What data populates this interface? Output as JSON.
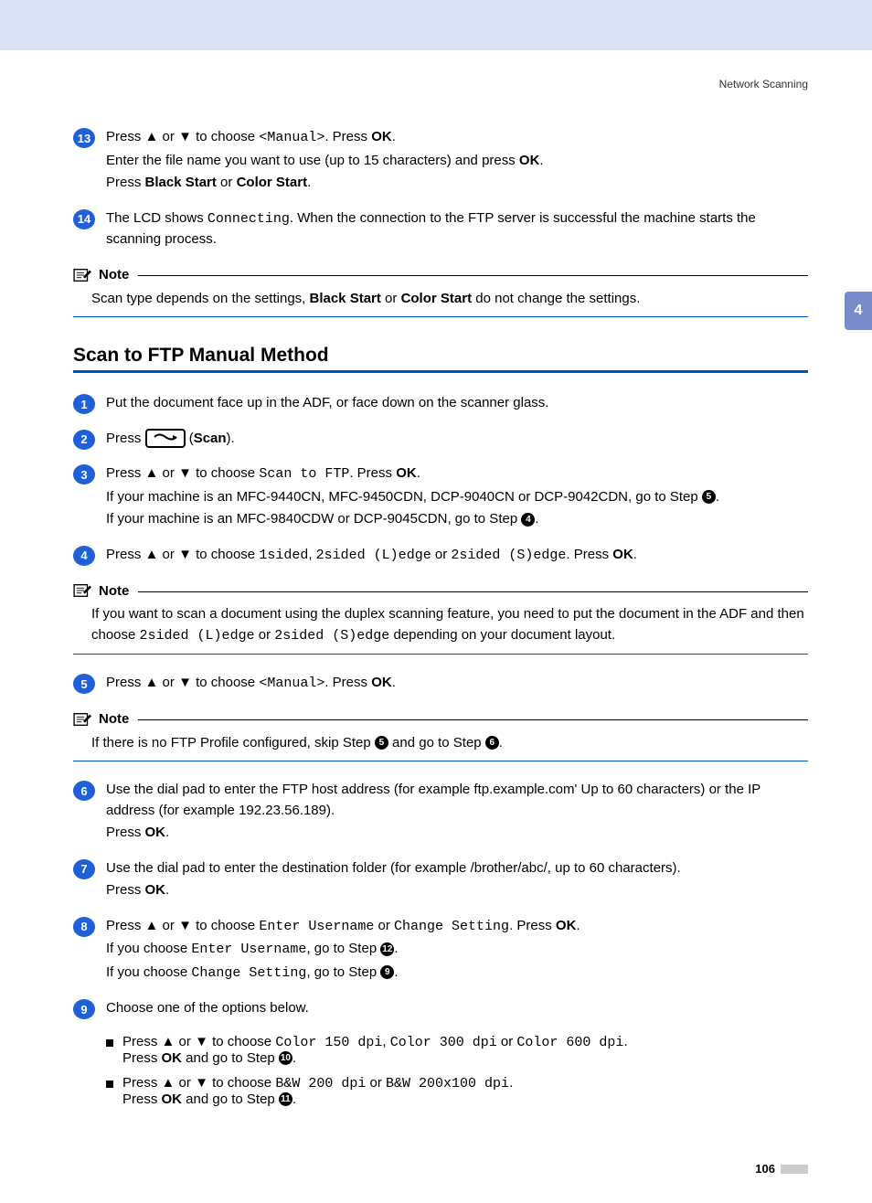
{
  "header": {
    "section": "Network Scanning"
  },
  "sideTab": "4",
  "topSteps": {
    "s13": {
      "num": "13",
      "l1a": "Press ",
      "l1b": " or ",
      "l1c": " to choose ",
      "l1mono": "<Manual>",
      "l1d": ". Press ",
      "l1ok": "OK",
      "l1e": ".",
      "l2a": "Enter the file name you want to use (up to 15 characters) and press ",
      "l2ok": "OK",
      "l2b": ".",
      "l3a": "Press ",
      "l3b": "Black Start",
      "l3c": " or ",
      "l3d": "Color Start",
      "l3e": "."
    },
    "s14": {
      "num": "14",
      "l1a": "The LCD shows ",
      "l1mono": "Connecting",
      "l1b": ". When the connection to the FTP server is successful the machine starts the scanning process."
    }
  },
  "note1": {
    "label": "Note",
    "textA": "Scan type depends on the settings, ",
    "b1": "Black Start",
    "mid": " or ",
    "b2": "Color Start",
    "textB": " do not change the settings."
  },
  "sectionTitle": "Scan to FTP Manual Method",
  "steps": {
    "s1": {
      "num": "1",
      "text": "Put the document face up in the ADF, or face down on the scanner glass."
    },
    "s2": {
      "num": "2",
      "a": "Press ",
      "b": " (",
      "scan": "Scan",
      "c": ")."
    },
    "s3": {
      "num": "3",
      "l1a": "Press ",
      "l1b": " or ",
      "l1c": " to choose ",
      "l1mono": "Scan to FTP",
      "l1d": ". Press ",
      "l1ok": "OK",
      "l1e": ".",
      "l2": "If your machine is an MFC-9440CN, MFC-9450CDN, DCP-9040CN or DCP-9042CDN, go to Step ",
      "l2ref": "5",
      "l2e": ".",
      "l3": "If your machine is an MFC-9840CDW or DCP-9045CDN, go to Step ",
      "l3ref": "4",
      "l3e": "."
    },
    "s4": {
      "num": "4",
      "a": "Press ",
      "b": " or ",
      "c": " to choose ",
      "m1": "1sided",
      "d": ", ",
      "m2": "2sided (L)edge",
      "e": " or ",
      "m3": "2sided (S)edge",
      "f": ". Press ",
      "ok": "OK",
      "g": "."
    },
    "s5": {
      "num": "5",
      "a": "Press ",
      "b": " or ",
      "c": " to choose ",
      "m": "<Manual>",
      "d": ".  Press ",
      "ok": "OK",
      "e": "."
    },
    "s6": {
      "num": "6",
      "l1": "Use the dial pad to enter the FTP host address (for example ftp.example.com' Up to 60 characters) or the IP address (for example 192.23.56.189).",
      "l2a": "Press ",
      "l2ok": "OK",
      "l2b": "."
    },
    "s7": {
      "num": "7",
      "l1": "Use the dial pad to enter the destination folder (for example /brother/abc/, up to 60 characters).",
      "l2a": "Press ",
      "l2ok": "OK",
      "l2b": "."
    },
    "s8": {
      "num": "8",
      "l1a": "Press ",
      "l1b": " or ",
      "l1c": " to choose ",
      "m1": "Enter Username",
      "l1d": " or ",
      "m2": "Change Setting",
      "l1e": ". Press ",
      "l1ok": "OK",
      "l1f": ".",
      "l2a": "If you choose ",
      "l2m": "Enter Username",
      "l2b": ", go to Step ",
      "l2ref": "12",
      "l2c": ".",
      "l3a": "If you choose ",
      "l3m": "Change Setting",
      "l3b": ", go to Step ",
      "l3ref": "9",
      "l3c": "."
    },
    "s9": {
      "num": "9",
      "l1": "Choose one of the options below.",
      "b1": {
        "a": "Press ",
        "b": " or ",
        "c": " to choose ",
        "m1": "Color 150 dpi",
        "d": ", ",
        "m2": "Color 300 dpi",
        "e": " or ",
        "m3": "Color 600 dpi",
        "f": ".",
        "g": "Press ",
        "ok": "OK",
        "h": " and go to Step ",
        "ref": "10",
        "i": "."
      },
      "b2": {
        "a": "Press ",
        "b": " or ",
        "c": " to choose ",
        "m1": "B&W 200 dpi",
        "d": " or ",
        "m2": "B&W 200x100 dpi",
        "e": ".",
        "g": "Press ",
        "ok": "OK",
        "h": " and go to Step ",
        "ref": "11",
        "i": "."
      }
    }
  },
  "note2": {
    "label": "Note",
    "a": "If you want to scan a document using the duplex scanning feature, you need to put the document in the ADF and then choose ",
    "m1": "2sided (L)edge",
    "b": " or ",
    "m2": "2sided (S)edge",
    "c": " depending on your document layout."
  },
  "note3": {
    "label": "Note",
    "a": "If there is no FTP Profile configured, skip Step ",
    "r1": "5",
    "b": " and go to Step ",
    "r2": "6",
    "c": "."
  },
  "arrows": {
    "up": "▲",
    "down": "▼"
  },
  "pageNum": "106"
}
